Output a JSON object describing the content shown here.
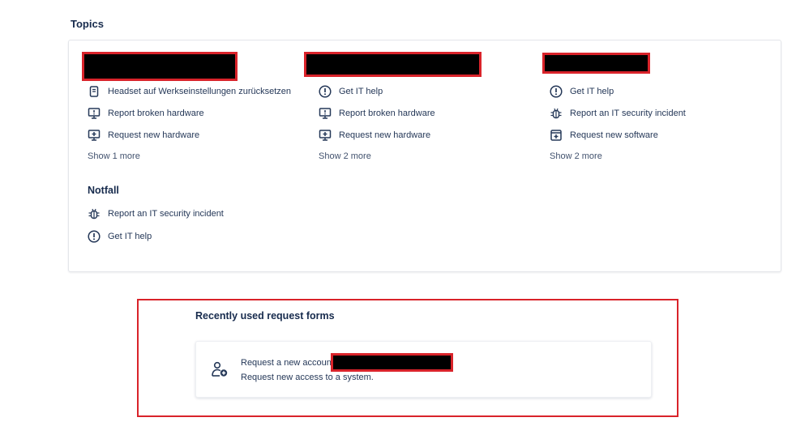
{
  "topics": {
    "heading": "Topics",
    "columns": [
      {
        "items": [
          {
            "label": "Headset auf Werkseinstellungen zurücksetzen",
            "icon": "document-icon"
          },
          {
            "label": "Report broken hardware",
            "icon": "monitor-icon"
          },
          {
            "label": "Request new hardware",
            "icon": "monitor-plus-icon"
          }
        ],
        "show_more": "Show 1 more"
      },
      {
        "items": [
          {
            "label": "Get IT help",
            "icon": "exclamation-circle-icon"
          },
          {
            "label": "Report broken hardware",
            "icon": "monitor-icon"
          },
          {
            "label": "Request new hardware",
            "icon": "monitor-plus-icon"
          }
        ],
        "show_more": "Show 2 more"
      },
      {
        "items": [
          {
            "label": "Get IT help",
            "icon": "exclamation-circle-icon"
          },
          {
            "label": "Report an IT security incident",
            "icon": "bug-icon"
          },
          {
            "label": "Request new software",
            "icon": "window-plus-icon"
          }
        ],
        "show_more": "Show 2 more"
      }
    ],
    "notfall": {
      "title": "Notfall",
      "items": [
        {
          "label": "Report an IT security incident",
          "icon": "bug-icon"
        },
        {
          "label": "Get IT help",
          "icon": "exclamation-circle-icon"
        }
      ]
    }
  },
  "recent": {
    "title": "Recently used request forms",
    "items": [
      {
        "name": "Request a new account",
        "description": "Request new access to a system.",
        "icon": "person-add-icon"
      }
    ]
  },
  "colors": {
    "redaction_border": "#d9232a",
    "text": "#172b4d",
    "muted": "#42526e"
  }
}
